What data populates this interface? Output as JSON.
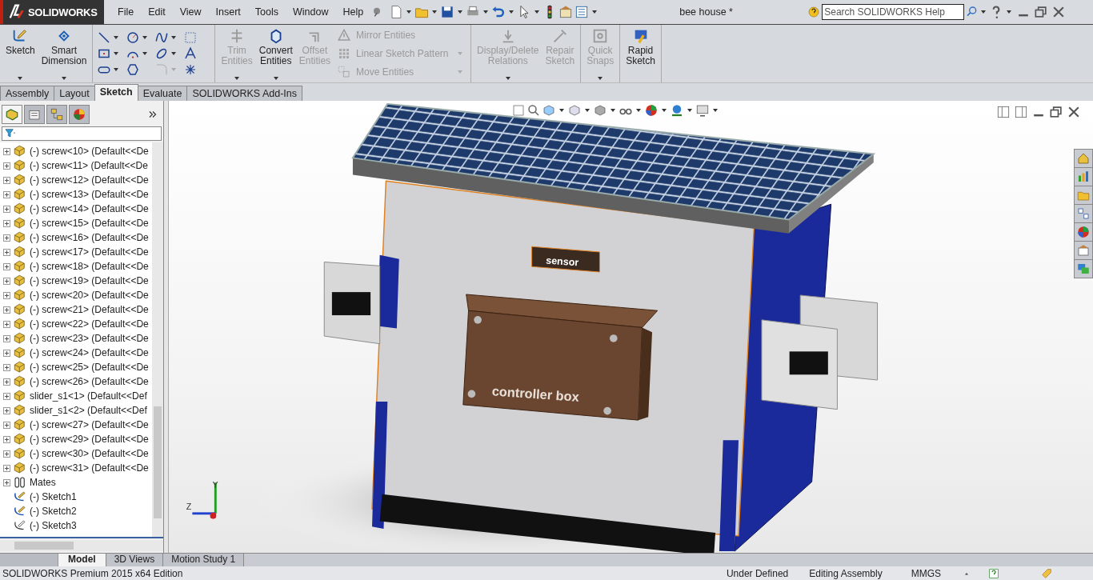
{
  "app": {
    "logo": "SOLIDWORKS",
    "menus": [
      "File",
      "Edit",
      "View",
      "Insert",
      "Tools",
      "Window",
      "Help"
    ],
    "title": "bee house *",
    "search": {
      "placeholder": "Search SOLIDWORKS Help"
    }
  },
  "command_manager": {
    "groups": [
      {
        "items": [
          {
            "kind": "large",
            "label": "Sketch",
            "disabled": false,
            "dropdown": true
          },
          {
            "kind": "large",
            "label": "Smart Dimension",
            "disabled": false,
            "dropdown": true
          }
        ]
      },
      {
        "items": [
          {
            "kind": "tool_grid",
            "tools": [
              {
                "disabled": false,
                "dropdown": true
              },
              {
                "disabled": false,
                "dropdown": true
              },
              {
                "disabled": false,
                "dropdown": true
              },
              {
                "disabled": false,
                "dropdown": false
              },
              {
                "disabled": false,
                "dropdown": true
              },
              {
                "disabled": false,
                "dropdown": true
              },
              {
                "disabled": false,
                "dropdown": true
              },
              {
                "disabled": false,
                "dropdown": false
              },
              {
                "disabled": false,
                "dropdown": true
              },
              {
                "disabled": false,
                "dropdown": false
              },
              {
                "disabled": true,
                "dropdown": true
              },
              {
                "disabled": false,
                "dropdown": false
              }
            ]
          }
        ]
      },
      {
        "items": [
          {
            "kind": "large",
            "label": "Trim Entities",
            "disabled": true,
            "dropdown": true
          },
          {
            "kind": "large",
            "label": "Convert Entities",
            "disabled": false,
            "dropdown": true
          },
          {
            "kind": "large",
            "label": "Offset Entities",
            "disabled": true,
            "dropdown": false
          },
          {
            "kind": "stack",
            "entries": [
              {
                "label": "Mirror Entities",
                "disabled": true,
                "dropdown": false
              },
              {
                "label": "Linear Sketch Pattern",
                "disabled": true,
                "dropdown": true
              },
              {
                "label": "Move Entities",
                "disabled": true,
                "dropdown": true
              }
            ]
          }
        ]
      },
      {
        "items": [
          {
            "kind": "large",
            "label": "Display/Delete Relations",
            "disabled": true,
            "dropdown": true
          },
          {
            "kind": "large",
            "label": "Repair Sketch",
            "disabled": true,
            "dropdown": false
          }
        ]
      },
      {
        "items": [
          {
            "kind": "large",
            "label": "Quick Snaps",
            "disabled": true,
            "dropdown": true
          }
        ]
      },
      {
        "items": [
          {
            "kind": "large",
            "label": "Rapid Sketch",
            "disabled": false,
            "dropdown": false
          }
        ]
      }
    ]
  },
  "tabs": [
    {
      "label": "Assembly",
      "selected": false
    },
    {
      "label": "Layout",
      "selected": false
    },
    {
      "label": "Sketch",
      "selected": true
    },
    {
      "label": "Evaluate",
      "selected": false
    },
    {
      "label": "SOLIDWORKS Add-Ins",
      "selected": false
    }
  ],
  "panel_tabs": [
    {
      "selected": true
    },
    {
      "selected": false
    },
    {
      "selected": false
    },
    {
      "selected": false
    }
  ],
  "tree": [
    {
      "kind": "component",
      "label": "(-) screw<10> (Default<<De"
    },
    {
      "kind": "component",
      "label": "(-) screw<11> (Default<<De"
    },
    {
      "kind": "component",
      "label": "(-) screw<12> (Default<<De"
    },
    {
      "kind": "component",
      "label": "(-) screw<13> (Default<<De"
    },
    {
      "kind": "component",
      "label": "(-) screw<14> (Default<<De"
    },
    {
      "kind": "component",
      "label": "(-) screw<15> (Default<<De"
    },
    {
      "kind": "component",
      "label": "(-) screw<16> (Default<<De"
    },
    {
      "kind": "component",
      "label": "(-) screw<17> (Default<<De"
    },
    {
      "kind": "component",
      "label": "(-) screw<18> (Default<<De"
    },
    {
      "kind": "component",
      "label": "(-) screw<19> (Default<<De"
    },
    {
      "kind": "component",
      "label": "(-) screw<20> (Default<<De"
    },
    {
      "kind": "component",
      "label": "(-) screw<21> (Default<<De"
    },
    {
      "kind": "component",
      "label": "(-) screw<22> (Default<<De"
    },
    {
      "kind": "component",
      "label": "(-) screw<23> (Default<<De"
    },
    {
      "kind": "component",
      "label": "(-) screw<24> (Default<<De"
    },
    {
      "kind": "component",
      "label": "(-) screw<25> (Default<<De"
    },
    {
      "kind": "component",
      "label": "(-) screw<26> (Default<<De"
    },
    {
      "kind": "component",
      "label": "slider_s1<1> (Default<<Def"
    },
    {
      "kind": "component",
      "label": "slider_s1<2> (Default<<Def"
    },
    {
      "kind": "component",
      "label": "(-) screw<27> (Default<<De"
    },
    {
      "kind": "component",
      "label": "(-) screw<29> (Default<<De"
    },
    {
      "kind": "component",
      "label": "(-) screw<30> (Default<<De"
    },
    {
      "kind": "component",
      "label": "(-) screw<31> (Default<<De"
    },
    {
      "kind": "mates",
      "label": "Mates"
    },
    {
      "kind": "sketch",
      "label": "(-) Sketch1"
    },
    {
      "kind": "sketch",
      "label": "(-) Sketch2"
    },
    {
      "kind": "sketch_plain",
      "label": "(-) Sketch3"
    }
  ],
  "viewport": {
    "model_labels": [
      "sensor",
      "controller box"
    ],
    "triad": [
      "Y",
      "Z"
    ]
  },
  "bottom_tabs": [
    {
      "label": "Model",
      "selected": true
    },
    {
      "label": "3D Views",
      "selected": false
    },
    {
      "label": "Motion Study 1",
      "selected": false
    }
  ],
  "status_bar": {
    "edition": "SOLIDWORKS Premium 2015 x64 Edition",
    "items": [
      "Under Defined",
      "Editing Assembly",
      "MMGS"
    ]
  }
}
